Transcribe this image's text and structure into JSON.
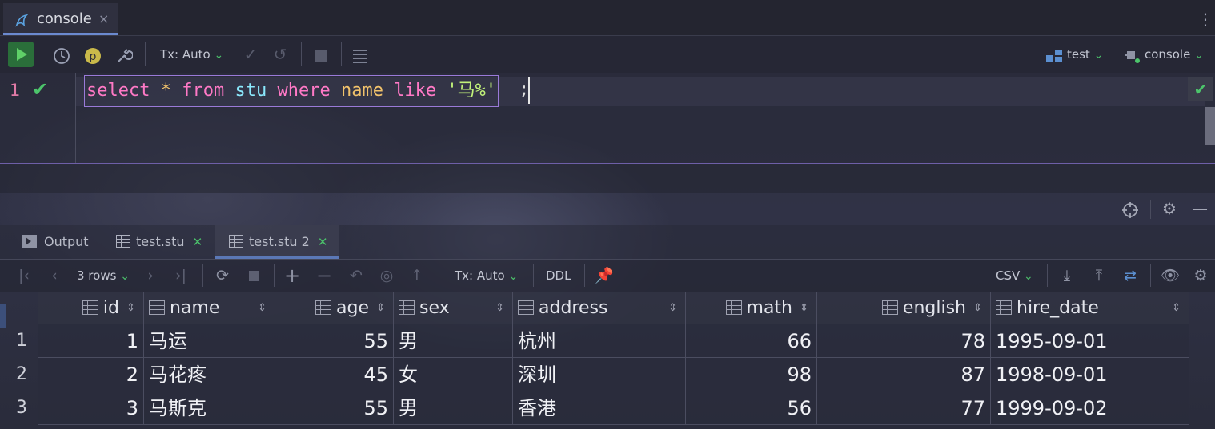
{
  "tabs": {
    "console_label": "console",
    "close_glyph": "×"
  },
  "toolbar": {
    "tx_mode": "Tx: Auto",
    "datasource": "test",
    "session": "console"
  },
  "editor": {
    "line_number": "1",
    "tokens": {
      "select": "select",
      "star": "*",
      "from": "from",
      "table": "stu",
      "where": "where",
      "column": "name",
      "like": "like",
      "pattern": "'马%'",
      "semicolon": ";"
    }
  },
  "result_tabs": [
    {
      "label": "Output",
      "icon": "console-output-icon"
    },
    {
      "label": "test.stu",
      "icon": "table-icon"
    },
    {
      "label": "test.stu 2",
      "icon": "table-icon",
      "active": true
    }
  ],
  "results_toolbar": {
    "rows_label": "3 rows",
    "tx_mode": "Tx: Auto",
    "ddl_label": "DDL",
    "export_format": "CSV"
  },
  "table": {
    "columns": [
      "id",
      "name",
      "age",
      "sex",
      "address",
      "math",
      "english",
      "hire_date"
    ],
    "row_numbers": [
      "1",
      "2",
      "3"
    ],
    "rows": [
      [
        "1",
        "马运",
        "55",
        "男",
        "杭州",
        "66",
        "78",
        "1995-09-01"
      ],
      [
        "2",
        "马花疼",
        "45",
        "女",
        "深圳",
        "98",
        "87",
        "1998-09-01"
      ],
      [
        "3",
        "马斯克",
        "55",
        "男",
        "香港",
        "56",
        "77",
        "1999-09-02"
      ]
    ]
  },
  "colors": {
    "keyword": "#ff79c6",
    "identifier": "#8be9fd",
    "string": "#c1f27a",
    "success_green": "#4cc56b"
  }
}
